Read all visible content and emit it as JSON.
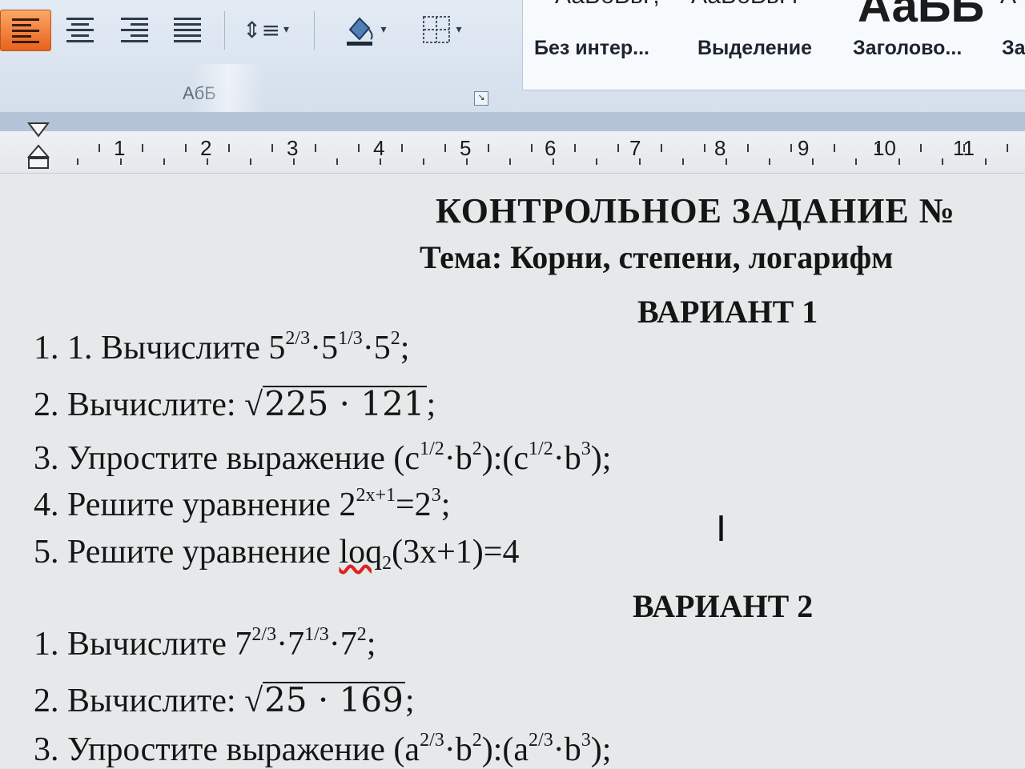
{
  "ribbon": {
    "paragraph_group_label": "АбБ",
    "styles": {
      "top_row": [
        "АаБбВвГ,",
        "АаБбВвГг",
        "АаБЬ",
        "А"
      ],
      "names": [
        "Без интер...",
        "Выделение",
        "Заголово...",
        "За"
      ]
    }
  },
  "ruler": {
    "numbers": [
      "1",
      "2",
      "3",
      "4",
      "5",
      "6",
      "7",
      "8",
      "9",
      "10",
      "11"
    ]
  },
  "document": {
    "title": "КОНТРОЛЬНОЕ ЗАДАНИЕ №",
    "topic": "Тема: Корни, степени, логарифм",
    "variant1": {
      "heading": "ВАРИАНТ 1",
      "t1": {
        "num": "1. 1. Вычислите 5",
        "e1": "2/3",
        "m1": "·5",
        "e2": "1/3",
        "m2": "·5",
        "e3": "2",
        "end": ";"
      },
      "t2": {
        "pre": "2. Вычислите: ",
        "root": "√",
        "rad": "225 · 121",
        "end": ";"
      },
      "t3": {
        "pre": "3. Упростите выражение (c",
        "e1": "1/2",
        "m1": "·b",
        "e2": "2",
        "m2": "):(c",
        "e3": "1/2",
        "m3": "·b",
        "e4": "3",
        "end": ");"
      },
      "t4": {
        "pre": "4. Решите уравнение 2",
        "e1": "2x+1",
        "m1": "=2",
        "e2": "3",
        "end": ";"
      },
      "t5": {
        "pre": "5. Решите уравнение ",
        "log": "loq",
        "base": "2",
        "end": "(3x+1)=4"
      }
    },
    "variant2": {
      "heading": "ВАРИАНТ 2",
      "t1": {
        "num": "1. Вычислите 7",
        "e1": "2/3",
        "m1": "·7",
        "e2": "1/3",
        "m2": "·7",
        "e3": "2",
        "end": ";"
      },
      "t2": {
        "pre": "2. Вычислите: ",
        "root": "√",
        "rad": "25 · 169",
        "end": ";"
      },
      "t3": {
        "pre": "3. Упростите выражение (a",
        "e1": "2/3",
        "m1": "·b",
        "e2": "2",
        "m2": "):(a",
        "e3": "2/3",
        "m3": "·b",
        "e4": "3",
        "end": ");"
      }
    }
  }
}
